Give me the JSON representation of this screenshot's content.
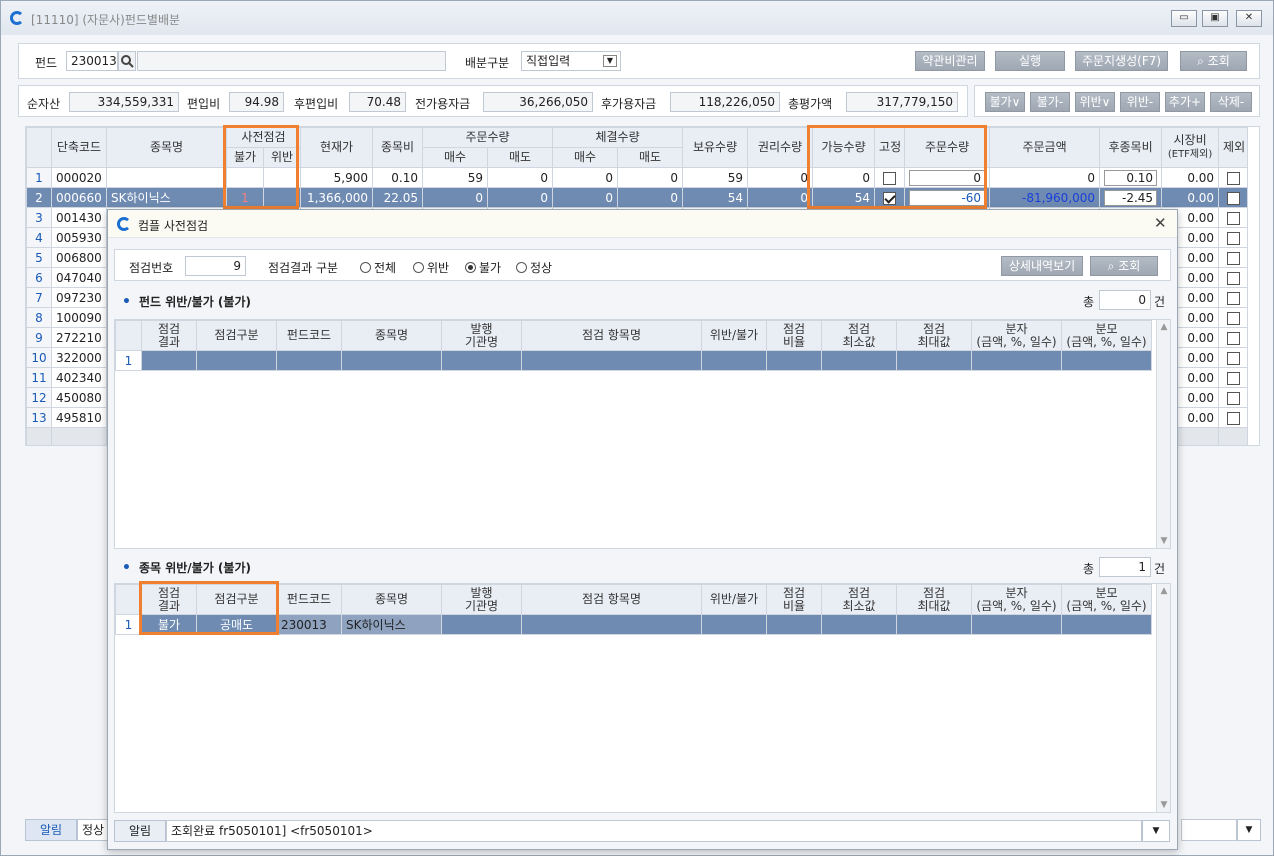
{
  "window": {
    "title": "[11110] (자문사)펀드별배분",
    "min": "▭",
    "restore": "▣",
    "close": "✕"
  },
  "filter": {
    "fund_label": "펀드",
    "fund_code": "230013",
    "fund_name": "",
    "alloc_label": "배분구분",
    "alloc_value": "직접입력",
    "buttons": [
      "약관비관리",
      "실행",
      "주문지생성(F7)",
      "조회"
    ]
  },
  "summary": {
    "items": [
      {
        "label": "순자산",
        "value": "334,559,331"
      },
      {
        "label": "편입비",
        "value": "94.98"
      },
      {
        "label": "후편입비",
        "value": "70.48"
      },
      {
        "label": "전가용자금",
        "value": "36,266,050"
      },
      {
        "label": "후가용자금",
        "value": "118,226,050"
      },
      {
        "label": "총평가액",
        "value": "317,779,150"
      }
    ],
    "tool_buttons": [
      "불가∨",
      "불가-",
      "위반∨",
      "위반-",
      "추가+",
      "삭제-"
    ]
  },
  "main_table": {
    "headers": {
      "code": "단축코드",
      "name": "종목명",
      "precheck": "사전점검",
      "bulga": "불가",
      "wiban": "위반",
      "price": "현재가",
      "weight": "종목비",
      "order_qty": "주문수량",
      "buy": "매수",
      "sell": "매도",
      "exec_qty": "체결수량",
      "hold": "보유수량",
      "right": "권리수량",
      "avail": "가능수량",
      "fix": "고정",
      "order_q": "주문수량",
      "order_amt": "주문금액",
      "after_w": "후종목비",
      "market_w": "시장비",
      "market_w2": "(ETF제외)",
      "excl": "제외"
    },
    "rows": [
      {
        "no": "1",
        "code": "000020",
        "name": "",
        "bulga": "",
        "wiban": "",
        "price": "5,900",
        "weight": "0.10",
        "obuy": "59",
        "osell": "0",
        "ebuy": "0",
        "esell": "0",
        "hold": "59",
        "right": "0",
        "avail": "0",
        "fixed": false,
        "oq": "0",
        "oamt": "0",
        "afterw": "0.10",
        "marketw": "0.00"
      },
      {
        "no": "2",
        "code": "000660",
        "name": "SK하이닉스",
        "bulga": "1",
        "wiban": "",
        "price": "1,366,000",
        "weight": "22.05",
        "obuy": "0",
        "osell": "0",
        "ebuy": "0",
        "esell": "0",
        "hold": "54",
        "right": "0",
        "avail": "54",
        "fixed": true,
        "oq": "-60",
        "oamt": "-81,960,000",
        "afterw": "-2.45",
        "marketw": "0.00"
      },
      {
        "no": "3",
        "code": "001430",
        "marketw": "0.00"
      },
      {
        "no": "4",
        "code": "005930",
        "marketw": "0.00"
      },
      {
        "no": "5",
        "code": "006800",
        "marketw": "0.00"
      },
      {
        "no": "6",
        "code": "047040",
        "marketw": "0.00"
      },
      {
        "no": "7",
        "code": "097230",
        "marketw": "0.00"
      },
      {
        "no": "8",
        "code": "100090",
        "marketw": "0.00"
      },
      {
        "no": "9",
        "code": "272210",
        "marketw": "0.00"
      },
      {
        "no": "10",
        "code": "322000",
        "marketw": "0.00"
      },
      {
        "no": "11",
        "code": "402340",
        "marketw": "0.00"
      },
      {
        "no": "12",
        "code": "450080",
        "marketw": "0.00"
      },
      {
        "no": "13",
        "code": "495810",
        "marketw": "0.00"
      }
    ]
  },
  "bottom": {
    "alert_tab": "알림",
    "status_tab": "정상"
  },
  "dialog": {
    "title": "컴플 사전점검",
    "check_no_label": "점검번호",
    "check_no": "9",
    "result_label": "점검결과 구분",
    "radios": [
      {
        "label": "전체",
        "on": false
      },
      {
        "label": "위반",
        "on": false
      },
      {
        "label": "불가",
        "on": true
      },
      {
        "label": "정상",
        "on": false
      }
    ],
    "detail_button": "상세내역보기",
    "search_button": "조회",
    "fund_section": {
      "title": "펀드  위반/불가 (불가)",
      "total_label": "총",
      "count": "0",
      "unit": "건"
    },
    "stock_section": {
      "title": "종목  위반/불가 (불가)",
      "total_label": "총",
      "count": "1",
      "unit": "건"
    },
    "grid_headers": [
      {
        "l1": "점검",
        "l2": "결과"
      },
      {
        "l1": "점검구분",
        "l2": ""
      },
      {
        "l1": "펀드코드",
        "l2": ""
      },
      {
        "l1": "종목명",
        "l2": ""
      },
      {
        "l1": "발행",
        "l2": "기관명"
      },
      {
        "l1": "점검 항목명",
        "l2": ""
      },
      {
        "l1": "위반/불가",
        "l2": ""
      },
      {
        "l1": "점검",
        "l2": "비율"
      },
      {
        "l1": "점검",
        "l2": "최소값"
      },
      {
        "l1": "점검",
        "l2": "최대값"
      },
      {
        "l1": "분자",
        "l2": "(금액, %, 일수)"
      },
      {
        "l1": "분모",
        "l2": "(금액, %, 일수)"
      }
    ],
    "fund_rows": [
      {
        "no": "1"
      }
    ],
    "stock_rows": [
      {
        "no": "1",
        "result": "불가",
        "type": "공매도",
        "fund": "230013",
        "name": "SK하이닉스"
      }
    ],
    "status_label": "알림",
    "status_msg": "조회완료 fr5050101] <fr5050101>"
  }
}
